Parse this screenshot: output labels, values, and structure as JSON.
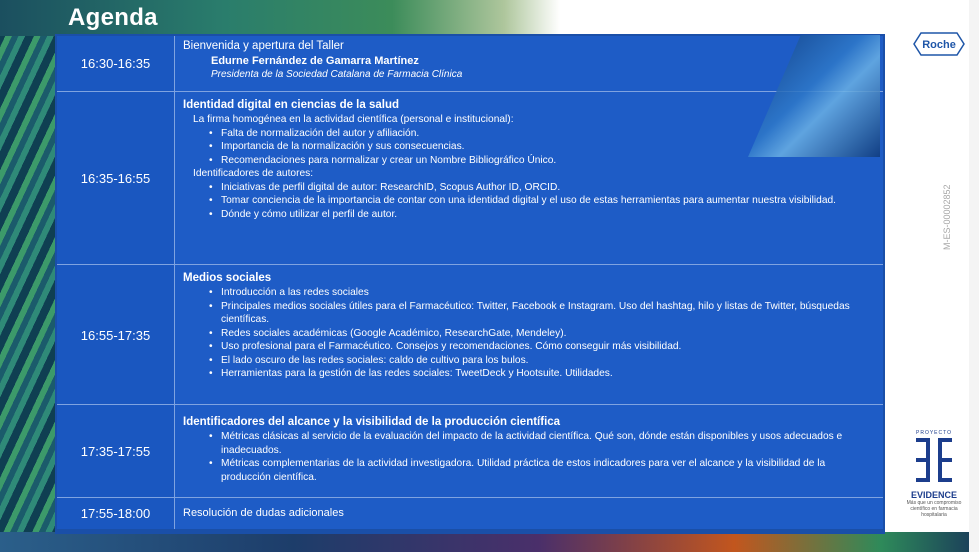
{
  "title": "Agenda",
  "logo": {
    "brand": "Roche"
  },
  "doc_code": "M-ES-00002852",
  "evidence_logo": {
    "top": "PROYECTO",
    "word": "EVIDENCE",
    "tagline": "Más que un compromiso científico en farmacia hospitalaria"
  },
  "colors": {
    "table_bg": "#1e5cc6",
    "time_bg": "#1a57c0",
    "border": "#1a4fa8"
  },
  "rows": [
    {
      "time": "16:30-16:35",
      "heading": "Bienvenida y apertura del Taller",
      "speaker": "Edurne Fernández de Gamarra Martínez",
      "role": "Presidenta de la Sociedad Catalana de Farmacia Clínica"
    },
    {
      "time": "16:35-16:55",
      "heading": "Identidad digital en ciencias de la salud",
      "sub1": "La firma homogénea en la actividad científica (personal e institucional):",
      "items1": [
        "Falta de normalización del autor y afiliación.",
        "Importancia de la normalización y sus consecuencias.",
        "Recomendaciones para normalizar y crear un Nombre Bibliográfico Único."
      ],
      "sub2": "Identificadores de autores:",
      "items2": [
        "Iniciativas de perfil digital de autor: ResearchID, Scopus Author ID, ORCID.",
        "Tomar conciencia de la importancia de contar con una identidad digital y el uso de estas herramientas para aumentar nuestra visibilidad.",
        "Dónde y cómo utilizar el perfil de autor."
      ]
    },
    {
      "time": "16:55-17:35",
      "heading": "Medios sociales",
      "items": [
        "Introducción a las redes sociales",
        "Principales medios sociales útiles para el Farmacéutico: Twitter, Facebook e Instagram. Uso del hashtag, hilo y listas de Twitter, búsquedas científicas.",
        "Redes sociales académicas (Google Académico, ResearchGate, Mendeley).",
        "Uso profesional para el Farmacéutico. Consejos y recomendaciones. Cómo conseguir más visibilidad.",
        "El lado oscuro de las redes sociales: caldo de cultivo para los bulos.",
        "Herramientas para la gestión de las redes sociales: TweetDeck y Hootsuite. Utilidades."
      ]
    },
    {
      "time": "17:35-17:55",
      "heading": "Identificadores del alcance y la visibilidad de la producción científica",
      "items": [
        "Métricas clásicas al servicio de la evaluación del impacto de la actividad científica. Qué son, dónde están disponibles y usos adecuados e inadecuados.",
        "Métricas complementarias de la actividad investigadora. Utilidad práctica de estos indicadores para ver el alcance y la visibilidad de la producción científica."
      ]
    },
    {
      "time": "17:55-18:00",
      "text": "Resolución de dudas adicionales"
    }
  ]
}
